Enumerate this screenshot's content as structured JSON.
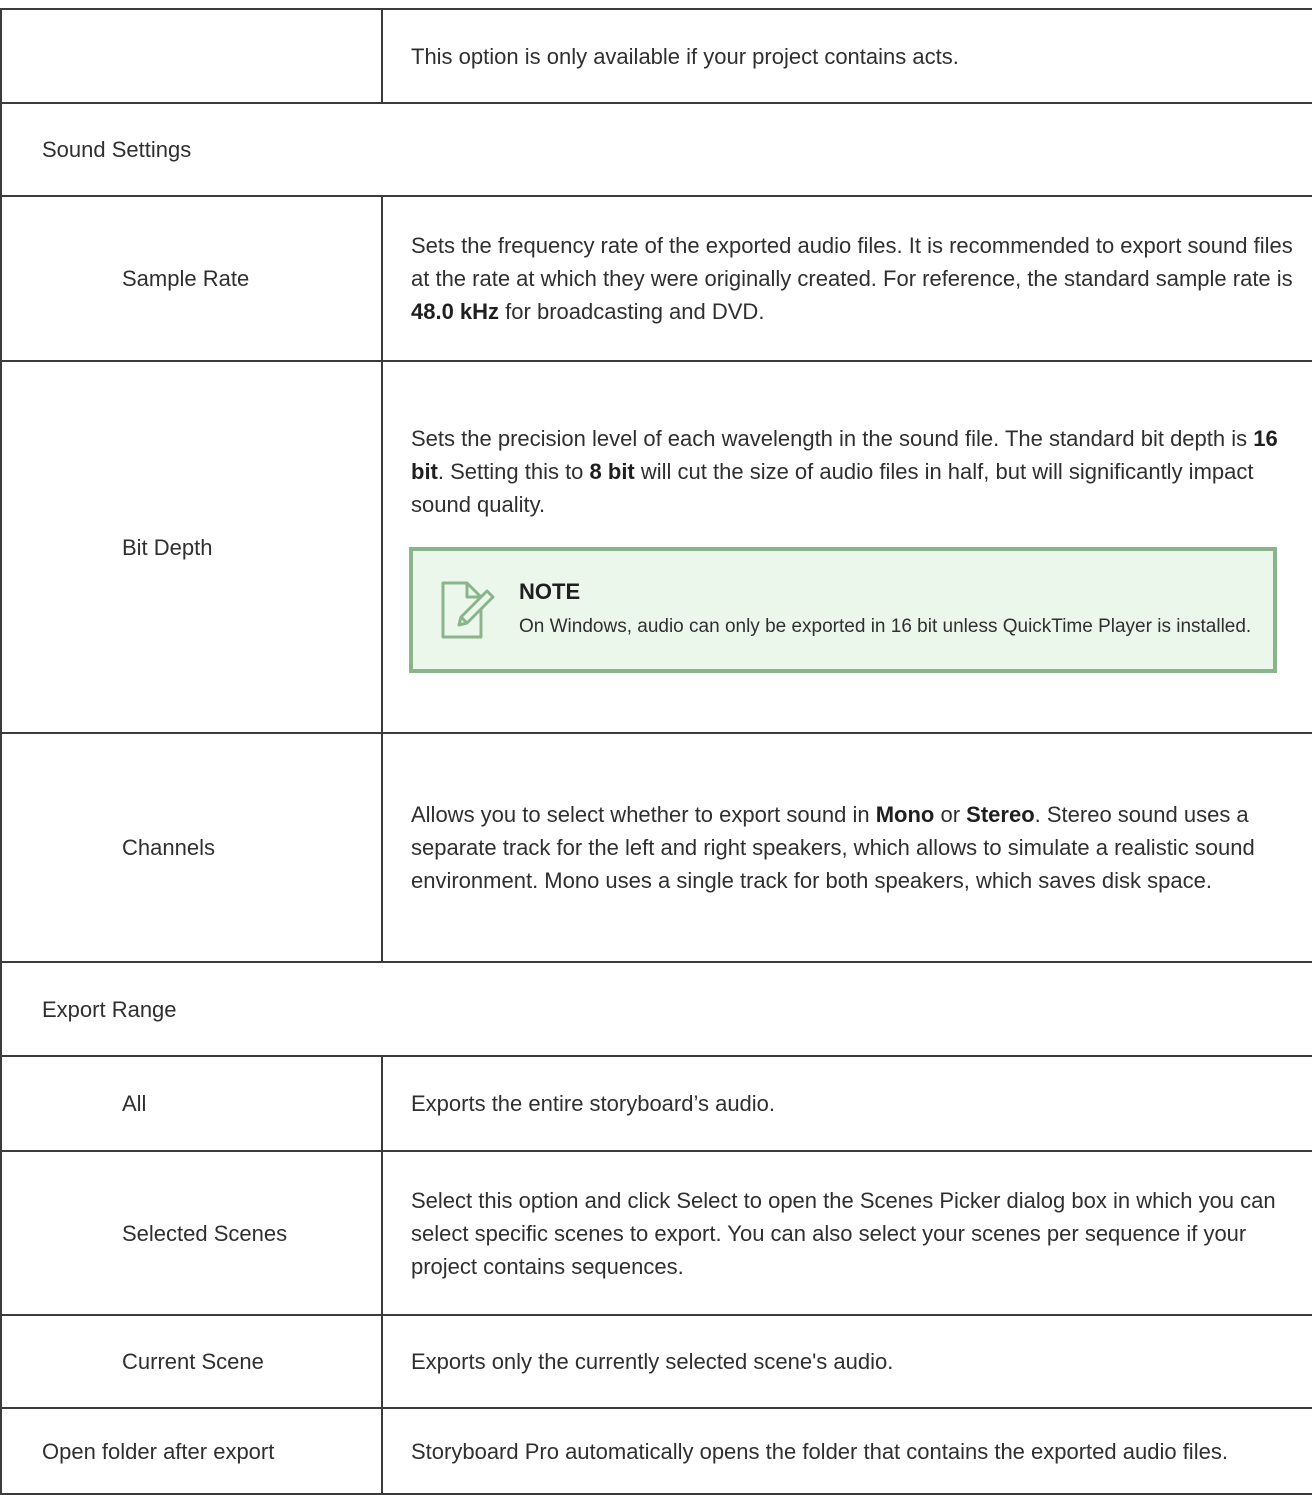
{
  "rows": {
    "acts": {
      "name": "",
      "desc": "This option is only available if your project contains acts."
    },
    "sound_settings": {
      "label": "Sound Settings"
    },
    "sample_rate": {
      "name": "Sample Rate",
      "desc_1": "Sets the frequency rate of the exported audio files. It is recommended to export sound files at the rate at which they were originally created. For reference, the standard sample rate is ",
      "desc_bold_1": "48.0 kHz",
      "desc_2": " for broadcasting and DVD."
    },
    "bit_depth": {
      "name": "Bit Depth",
      "desc_1": "Sets the precision level of each wavelength in the sound file. The standard bit depth is ",
      "desc_bold_1": "16 bit",
      "desc_2": ". Setting this to ",
      "desc_bold_2": "8 bit",
      "desc_3": " will cut the size of audio files in half, but will significantly impact sound quality.",
      "note": {
        "icon": "note-edit-icon",
        "title": "NOTE",
        "text": "On Windows, audio can only be exported in 16 bit unless QuickTime Player is installed."
      }
    },
    "channels": {
      "name": "Channels",
      "desc_1": "Allows you to select whether to export sound in ",
      "desc_bold_1": "Mono",
      "desc_2": " or ",
      "desc_bold_2": "Stereo",
      "desc_3": ". Stereo sound uses a separate track for the left and right speakers, which allows to simulate a realistic sound environment. Mono uses a single track for both speakers, which saves disk space."
    },
    "export_range": {
      "label": "Export Range"
    },
    "all": {
      "name": "All",
      "desc": "Exports the entire storyboard’s audio."
    },
    "selected_scenes": {
      "name": "Selected Scenes",
      "desc": "Select this option and click Select to open the Scenes Picker dialog box in which you can select specific scenes to export. You can also select your scenes per sequence if your project contains sequences."
    },
    "current_scene": {
      "name": "Current Scene",
      "desc": "Exports only the currently selected scene's audio."
    },
    "open_folder": {
      "name": "Open folder after export",
      "desc": "Storyboard Pro automatically opens the folder that contains the exported audio files."
    }
  },
  "colors": {
    "border": "#3b3b3b",
    "note_border": "#8ab58a",
    "note_background": "#ecf7ec",
    "text": "#2f2f2f"
  }
}
